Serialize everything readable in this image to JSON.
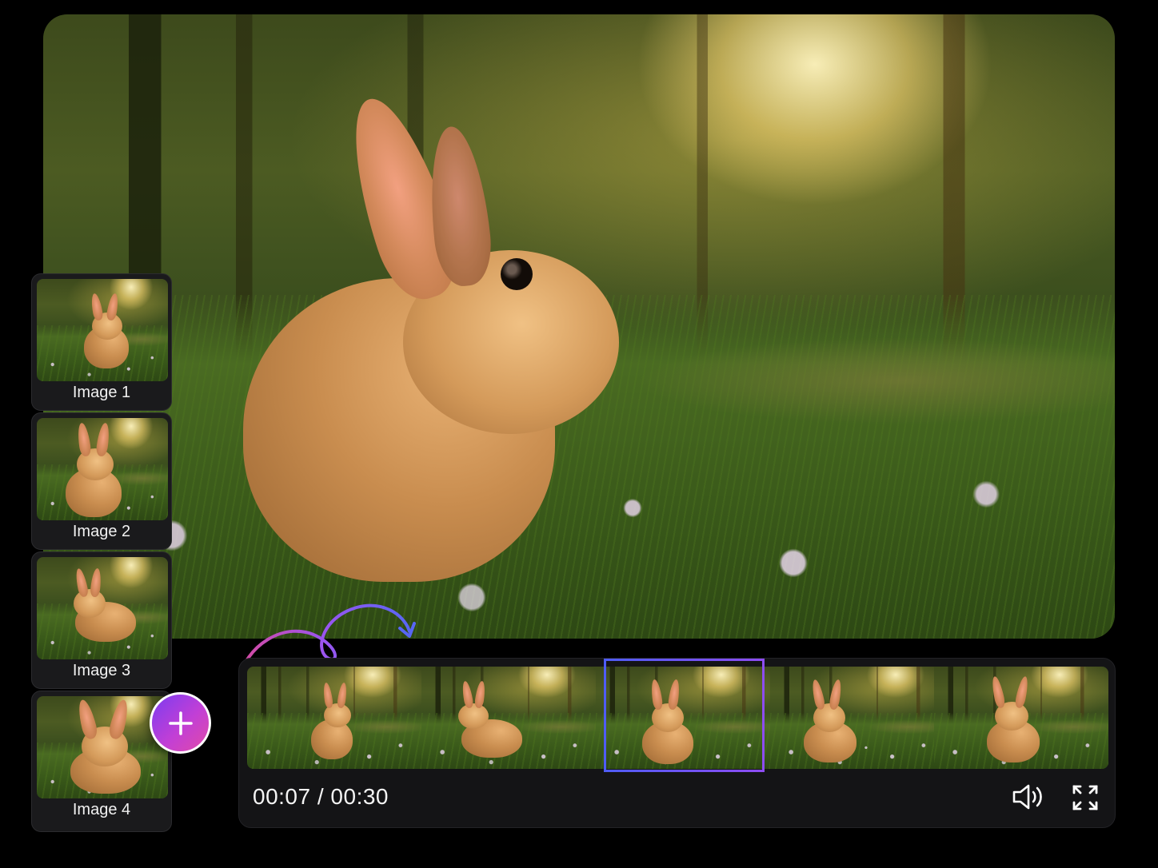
{
  "thumbnails": [
    {
      "label": "Image 1"
    },
    {
      "label": "Image 2"
    },
    {
      "label": "Image 3"
    },
    {
      "label": "Image 4"
    }
  ],
  "add_button": {
    "icon": "plus-icon"
  },
  "player": {
    "current_time": "00:07",
    "separator": " / ",
    "duration": "00:30",
    "volume_icon": "volume-icon",
    "fullscreen_icon": "fullscreen-icon"
  },
  "colors": {
    "accent_start": "#4f5cf5",
    "accent_end": "#8d4cf2",
    "add_button_gradient": [
      "#7b3cf0",
      "#c13fd6",
      "#e14aa8"
    ],
    "panel_bg": "#141416",
    "page_bg": "#000000"
  }
}
